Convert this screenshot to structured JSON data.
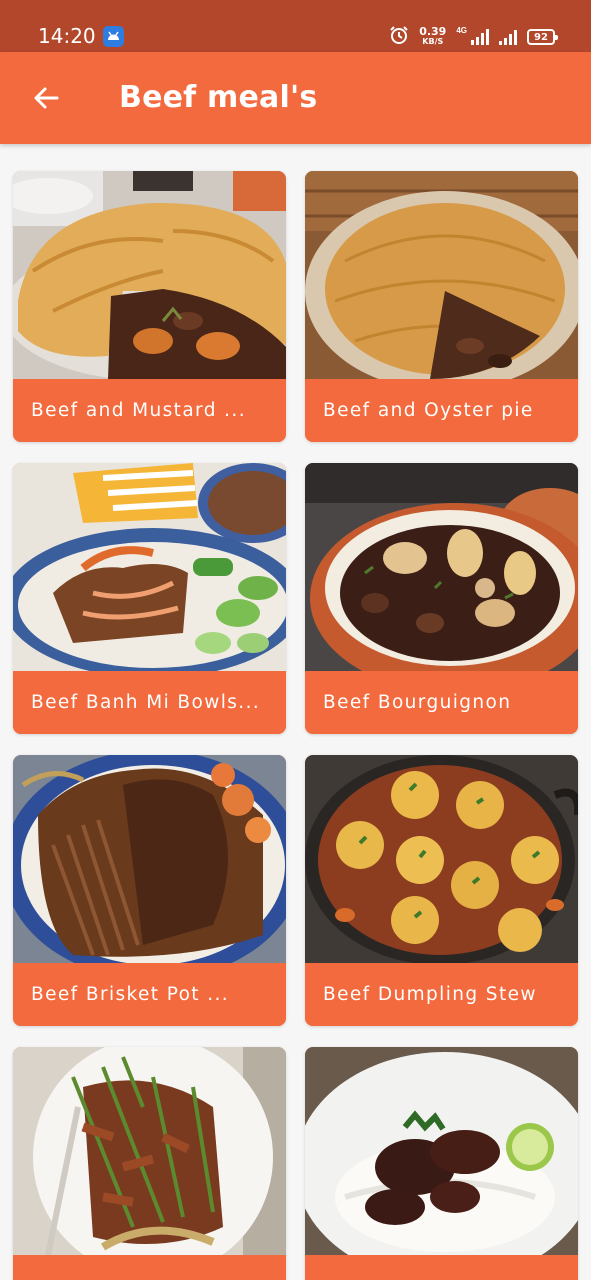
{
  "status_bar": {
    "time": "14:20",
    "net_speed_value": "0.39",
    "net_speed_unit": "KB/S",
    "network_type": "4G",
    "battery": "92",
    "icons": [
      "app-notification-icon",
      "alarm-icon",
      "signal-icon",
      "battery-icon"
    ]
  },
  "app_bar": {
    "back_icon": "arrow-left-icon",
    "title": "Beef meal's"
  },
  "colors": {
    "status_bar": "#b2472b",
    "accent": "#f26a3d",
    "background": "#f6f6f6"
  },
  "meals": [
    {
      "title": "Beef and Mustard ...",
      "image": "beef-pie-photo"
    },
    {
      "title": "Beef and Oyster pie",
      "image": "oyster-pie-photo"
    },
    {
      "title": "Beef Banh Mi Bowls...",
      "image": "banh-mi-bowl-photo"
    },
    {
      "title": "Beef Bourguignon",
      "image": "bourguignon-photo"
    },
    {
      "title": "Beef Brisket Pot ...",
      "image": "brisket-photo"
    },
    {
      "title": "Beef Dumpling Stew",
      "image": "dumpling-stew-photo"
    },
    {
      "title": "",
      "image": "stir-fry-photo"
    },
    {
      "title": "",
      "image": "beef-rice-photo"
    }
  ]
}
